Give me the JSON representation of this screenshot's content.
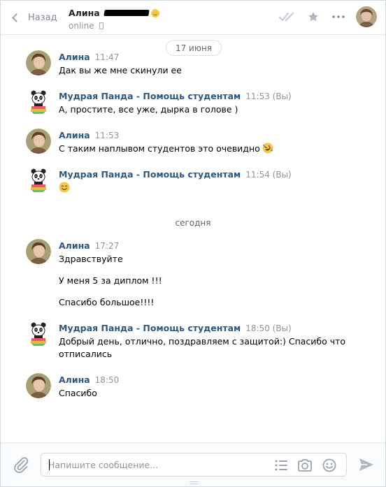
{
  "header": {
    "back_label": "Назад",
    "peer_name": "Алина",
    "peer_status": "online"
  },
  "date_pill": "17 июня",
  "today_label": "сегодня",
  "messages": [
    {
      "author": "Алина",
      "time": "11:47",
      "lines": [
        "Дак вы же мне скинули ее"
      ]
    },
    {
      "author": "Мудрая Панда - Помощь студентам",
      "time": "11:53 (Вы)",
      "lines": [
        "А, простите, все уже, дырка в голове )"
      ]
    },
    {
      "author": "Алина",
      "time": "11:53",
      "lines": [
        "С таким наплывом студентов это очевидно"
      ]
    },
    {
      "author": "Мудрая Панда - Помощь студентам",
      "time": "11:54 (Вы)",
      "lines": []
    },
    {
      "author": "Алина",
      "time": "17:27",
      "lines": [
        "Здравствуйте",
        "У меня 5 за диплом !!!",
        "Спасибо большое!!!!"
      ]
    },
    {
      "author": "Мудрая Панда - Помощь студентам",
      "time": "18:50 (Вы)",
      "lines": [
        "Добрый день, отлично, поздравляем с защитой:) Спасибо что",
        "отписались"
      ]
    },
    {
      "author": "Алина",
      "time": "18:50",
      "lines": [
        "Спасибо"
      ]
    }
  ],
  "composer": {
    "placeholder": "Напишите сообщение..."
  },
  "colors": {
    "author_link": "#2a5885",
    "muted": "#939393",
    "border": "#d3d9de",
    "icon": "#99a2ad"
  }
}
